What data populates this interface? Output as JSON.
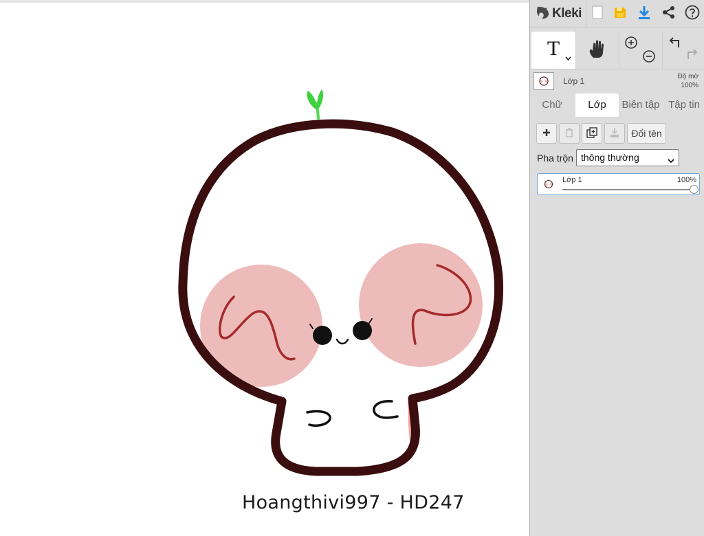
{
  "app": {
    "name": "Kleki",
    "colors": {
      "panel_bg": "#dddddd",
      "accent_blue": "#1e88e5",
      "save_yellow": "#f4b400"
    }
  },
  "topbar": {
    "icons": [
      "kleki-logo-icon",
      "new-image-icon",
      "save-icon",
      "download-icon",
      "share-icon",
      "help-icon"
    ]
  },
  "tools": {
    "items": [
      {
        "name": "text-tool",
        "icon": "text-T-icon",
        "glyph": "T",
        "active": true
      },
      {
        "name": "hand-tool",
        "icon": "hand-icon"
      },
      {
        "name": "zoom",
        "icon": "zoom-in-out-icon"
      },
      {
        "name": "undo-redo",
        "icon": "undo-redo-icon"
      }
    ]
  },
  "layer_bar": {
    "layer_name": "Lớp 1",
    "opacity_label": "Độ mờ",
    "opacity_value": "100%"
  },
  "tabs": [
    {
      "label": "Chữ",
      "active": false
    },
    {
      "label": "Lớp",
      "active": true
    },
    {
      "label": "Biên tập",
      "active": false
    },
    {
      "label": "Tập tin",
      "active": false
    }
  ],
  "layers": {
    "buttons": {
      "add": "add-layer-icon",
      "delete": "delete-layer-icon",
      "duplicate": "duplicate-layer-icon",
      "merge": "merge-layer-icon",
      "rename_label": "Đổi tên"
    },
    "blend_label": "Pha trộn",
    "blend_value": "thông thường",
    "list": [
      {
        "name": "Lớp 1",
        "opacity_text": "100%",
        "opacity": 1.0,
        "selected": true
      }
    ]
  },
  "canvas": {
    "signature": "Hoangthivi997 - HD247"
  }
}
